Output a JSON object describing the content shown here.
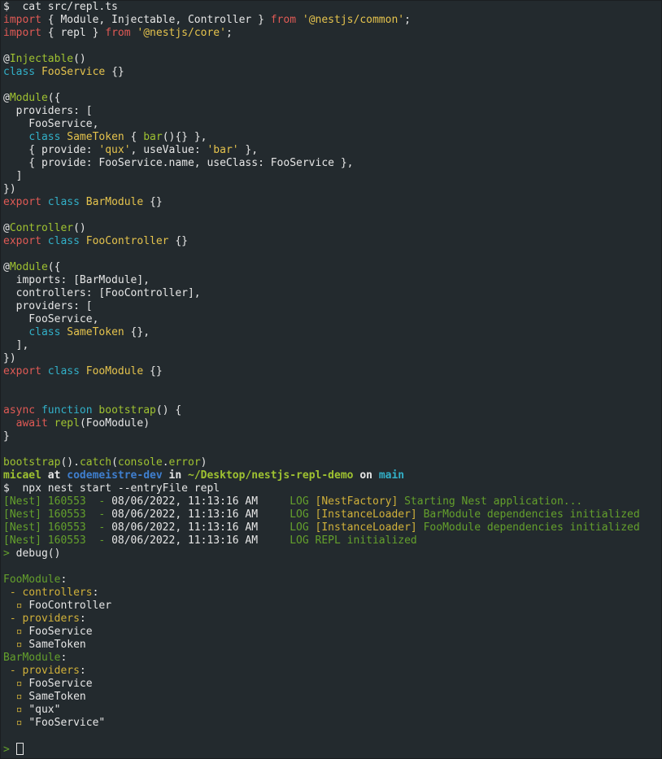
{
  "command1": {
    "prompt": "$",
    "text": "  cat src/repl.ts"
  },
  "code": {
    "l1": {
      "a": "import",
      "b": " { Module, Injectable, Controller } ",
      "c": "from",
      "d": " ",
      "e": "'@nestjs/common'",
      "f": ";"
    },
    "l2": {
      "a": "import",
      "b": " { repl } ",
      "c": "from",
      "d": " ",
      "e": "'@nestjs/core'",
      "f": ";"
    },
    "l4": {
      "a": "@",
      "b": "Injectable",
      "c": "()"
    },
    "l5": {
      "a": "class",
      "b": " ",
      "c": "FooService",
      "d": " {}"
    },
    "l7": {
      "a": "@",
      "b": "Module",
      "c": "({"
    },
    "l8": "  providers: [",
    "l9": "    FooService,",
    "l10": {
      "a": "    ",
      "b": "class",
      "c": " ",
      "d": "SameToken",
      "e": " { ",
      "f": "bar",
      "g": "(){} },"
    },
    "l11": {
      "a": "    { provide: ",
      "b": "'qux'",
      "c": ", useValue: ",
      "d": "'bar'",
      "e": " },"
    },
    "l12": "    { provide: FooService.name, useClass: FooService },",
    "l13": "  ]",
    "l14": "})",
    "l15": {
      "a": "export",
      "b": " ",
      "c": "class",
      "d": " ",
      "e": "BarModule",
      "f": " {}"
    },
    "l17": {
      "a": "@",
      "b": "Controller",
      "c": "()"
    },
    "l18": {
      "a": "export",
      "b": " ",
      "c": "class",
      "d": " ",
      "e": "FooController",
      "f": " {}"
    },
    "l20": {
      "a": "@",
      "b": "Module",
      "c": "({"
    },
    "l21": "  imports: [BarModule],",
    "l22": "  controllers: [FooController],",
    "l23": "  providers: [",
    "l24": "    FooService,",
    "l25": {
      "a": "    ",
      "b": "class",
      "c": " ",
      "d": "SameToken",
      "e": " {},"
    },
    "l26": "  ],",
    "l27": "})",
    "l28": {
      "a": "export",
      "b": " ",
      "c": "class",
      "d": " ",
      "e": "FooModule",
      "f": " {}"
    },
    "l31": {
      "a": "async",
      "b": " ",
      "c": "function",
      "d": " ",
      "e": "bootstrap",
      "f": "() {"
    },
    "l32": {
      "a": "  ",
      "b": "await",
      "c": " ",
      "d": "repl",
      "e": "(FooModule)"
    },
    "l33": "}",
    "l35": {
      "a": "bootstrap",
      "b": "().",
      "c": "catch",
      "d": "(",
      "e": "console",
      "f": ".",
      "g": "error",
      "h": ")"
    }
  },
  "prompt_line": {
    "user": "micael",
    "at": " at ",
    "host": "codemeistre-dev",
    "in": " in ",
    "path": "~/Desktop/nestjs-repl-demo",
    "on": " on ",
    "branch": "main"
  },
  "command2": {
    "prompt": "$",
    "text": "  npx nest start --entryFile repl"
  },
  "logs": [
    {
      "prefix": "[Nest] 160553  - ",
      "date": "08/06/2022, 11:13:16 AM",
      "level": "     LOG ",
      "context": "[NestFactory]",
      "message": " Starting Nest application..."
    },
    {
      "prefix": "[Nest] 160553  - ",
      "date": "08/06/2022, 11:13:16 AM",
      "level": "     LOG ",
      "context": "[InstanceLoader]",
      "message": " BarModule dependencies initialized"
    },
    {
      "prefix": "[Nest] 160553  - ",
      "date": "08/06/2022, 11:13:16 AM",
      "level": "     LOG ",
      "context": "[InstanceLoader]",
      "message": " FooModule dependencies initialized"
    },
    {
      "prefix": "[Nest] 160553  - ",
      "date": "08/06/2022, 11:13:16 AM",
      "level": "     LOG ",
      "context": "",
      "message": "REPL initialized"
    }
  ],
  "repl_command": {
    "prompt": ">",
    "text": " debug()"
  },
  "debug_output": {
    "foo_module": "FooModule",
    "bar_module": "BarModule",
    "colon": ":",
    "controllers_label": " - controllers",
    "providers_label": " - providers",
    "bullet": "  ▫ ",
    "foo_controllers": [
      "FooController"
    ],
    "foo_providers": [
      "FooService",
      "SameToken"
    ],
    "bar_providers": [
      "FooService",
      "SameToken",
      "\"qux\"",
      "\"FooService\""
    ]
  },
  "final_prompt": ">"
}
